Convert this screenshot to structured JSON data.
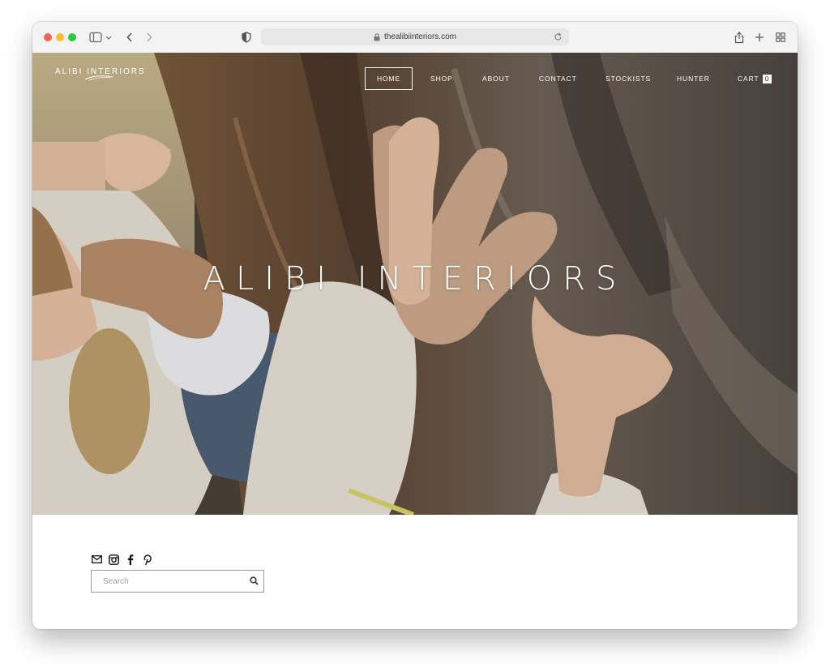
{
  "browser": {
    "url": "thealibiinteriors.com"
  },
  "site": {
    "logo_text": "ALIBI INTERIORS",
    "hero_title": "ALIBI INTERIORS",
    "nav": [
      {
        "label": "HOME",
        "active": true
      },
      {
        "label": "SHOP"
      },
      {
        "label": "ABOUT"
      },
      {
        "label": "CONTACT"
      },
      {
        "label": "STOCKISTS"
      },
      {
        "label": "HUNTER"
      },
      {
        "label": "CART"
      }
    ],
    "cart_count": "0"
  },
  "footer": {
    "social_icons": [
      "mail-icon",
      "instagram-icon",
      "facebook-icon",
      "pinterest-icon"
    ],
    "search_placeholder": "Search"
  }
}
